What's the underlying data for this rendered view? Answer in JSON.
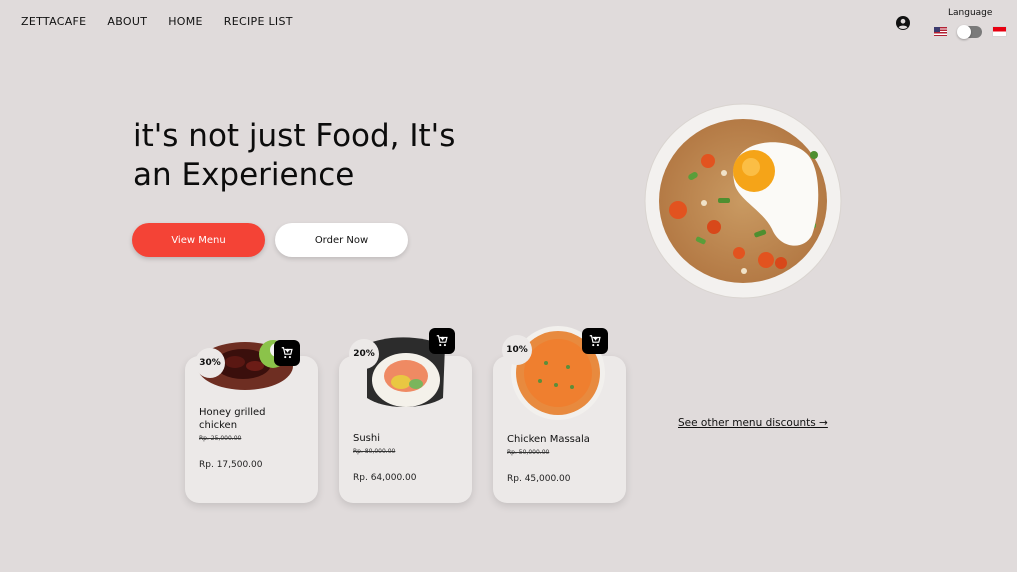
{
  "nav": {
    "items": [
      {
        "label": "ZETTACAFE"
      },
      {
        "label": "ABOUT"
      },
      {
        "label": "HOME"
      },
      {
        "label": "RECIPE LIST"
      }
    ]
  },
  "header": {
    "account_icon": "account-circle-icon",
    "language_label": "Language",
    "flags": [
      "us-flag-icon",
      "indonesia-flag-icon"
    ]
  },
  "hero": {
    "headline": "it's not just Food, It's an Experience",
    "view_menu_label": "View Menu",
    "order_now_label": "Order Now"
  },
  "cards": [
    {
      "discount": "30%",
      "name": "Honey grilled chicken",
      "old_price": "Rp. 25,000.00",
      "new_price": "Rp. 17,500.00"
    },
    {
      "discount": "20%",
      "name": "Sushi",
      "old_price": "Rp. 80,000.00",
      "new_price": "Rp. 64,000.00"
    },
    {
      "discount": "10%",
      "name": "Chicken Massala",
      "old_price": "Rp. 50,000.00",
      "new_price": "Rp. 45,000.00"
    }
  ],
  "see_other_label": "See other menu discounts →",
  "colors": {
    "background": "#e0dbdb",
    "accent": "#f44336",
    "card": "#ece9e8"
  }
}
